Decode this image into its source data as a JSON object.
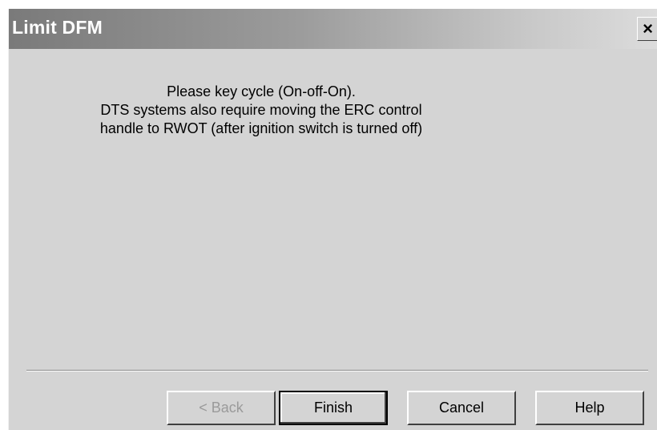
{
  "window": {
    "title": "Limit DFM",
    "close_glyph": "×"
  },
  "message": {
    "lines": [
      "Please key cycle (On-off-On).",
      "DTS systems also require moving the ERC control",
      "handle to RWOT (after ignition switch is turned off)"
    ]
  },
  "buttons": {
    "back_label": "< Back",
    "finish_label": "Finish",
    "cancel_label": "Cancel",
    "help_label": "Help",
    "back_enabled": false,
    "default_button": "Finish"
  }
}
